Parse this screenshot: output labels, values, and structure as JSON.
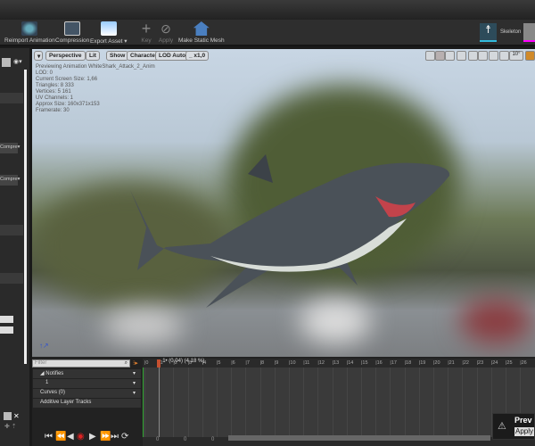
{
  "toolbar": {
    "items": [
      {
        "label": "Reimport Animation",
        "enabled": true
      },
      {
        "label": "Compression",
        "enabled": true
      },
      {
        "label": "Export Asset",
        "enabled": true
      },
      {
        "label": "Key",
        "enabled": false
      },
      {
        "label": "Apply",
        "enabled": false
      },
      {
        "label": "Make Static Mesh",
        "enabled": true
      }
    ],
    "skeleton_label": "Skeleton"
  },
  "left_panel": {
    "dropdown1": "Compre",
    "dropdown2": "Compre"
  },
  "viewport": {
    "buttons": {
      "perspective": "Perspective",
      "lit": "Lit",
      "show": "Show",
      "character": "Character",
      "lod": "LOD Auto",
      "speed": "x1,0"
    },
    "snap_angle": "10°",
    "info": [
      "Previewing Animation WhiteShark_Attack_2_Anim",
      "LOD: 0",
      "Current Screen Size: 1,66",
      "Triangles: 8 333",
      "Vertices: 5 161",
      "UV Channels: 1",
      "Approx Size: 160x371x153",
      "Framerate: 30"
    ]
  },
  "timeline": {
    "filter_placeholder": "Filter",
    "tracks": {
      "notifies": "Notifies",
      "notify_1": "1",
      "curves": "Curves",
      "curves_count": "(0)",
      "additive": "Additive Layer Tracks"
    },
    "playhead_label": "1• (0,04) (4,18 %)",
    "playhead_frame": 1,
    "frame_count": 27,
    "range_labels": [
      "0",
      "0",
      "0"
    ]
  },
  "toast": {
    "title": "Prev",
    "button": "Apply"
  }
}
